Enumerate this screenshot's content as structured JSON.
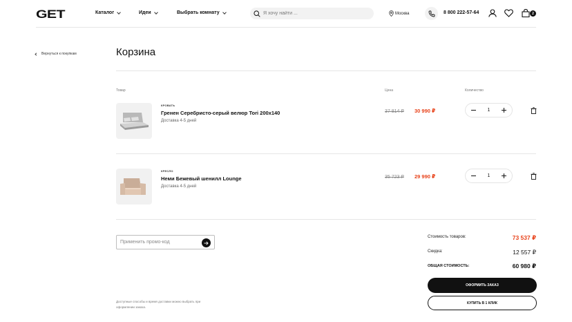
{
  "header": {
    "logo": "GET",
    "nav": [
      {
        "label": "Каталог"
      },
      {
        "label": "Идеи"
      },
      {
        "label": "Выбрать комнату"
      }
    ],
    "search_placeholder": "Я хочу найти ...",
    "city": "Москва",
    "phone": "8 800 222-57-64",
    "cart_count": "2"
  },
  "page": {
    "back_label": "Вернуться к покупкам",
    "title": "Корзина",
    "columns": {
      "product": "Товар",
      "price": "Цена",
      "quantity": "Количество"
    }
  },
  "items": [
    {
      "category": "Кровать",
      "name": "Гренен Серебристо-серый велюр Tori 200x140",
      "delivery": "Доставка 4-5 дней",
      "old_price": "37 814 ₽",
      "price": "30 990 ₽",
      "qty": "1"
    },
    {
      "category": "Кресло",
      "name": "Неми Бежевый шенилл Lounge",
      "delivery": "Доставка 4-5 дней",
      "old_price": "35 723 ₽",
      "price": "29 990 ₽",
      "qty": "1"
    }
  ],
  "promo": {
    "placeholder": "Применить промо-код"
  },
  "note": "Доступные способы и время доставки можно выбрать при оформлении заказа.",
  "summary": {
    "goods_label": "Стоимость товаров:",
    "goods_value": "73 537 ₽",
    "discount_label": "Скидка:",
    "discount_value": "12 557 ₽",
    "total_label": "Общая стоимость:",
    "total_value": "60 980 ₽",
    "checkout_label": "Оформить заказ",
    "oneclick_label": "Купить в 1 клик"
  },
  "colors": {
    "accent_price": "#e8431b",
    "primary": "#111111"
  }
}
